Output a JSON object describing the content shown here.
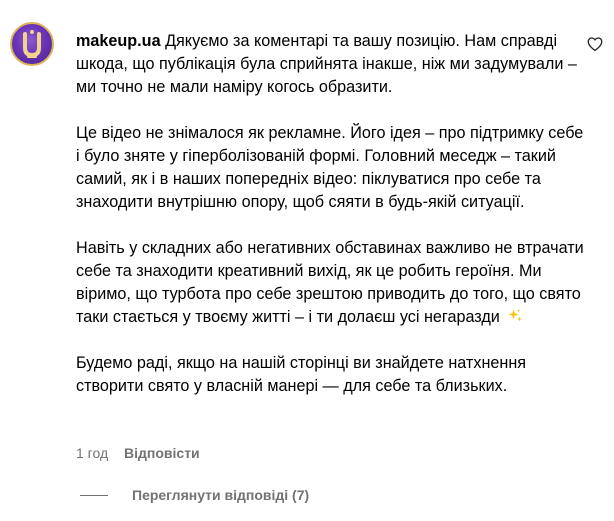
{
  "comment": {
    "username": "makeup.ua",
    "paragraph_1": "Дякуємо за коментарі та вашу позицію. Нам справді шкода, що публікація була сприйнята інакше, ніж ми задумували – ми точно не мали наміру когось образити.",
    "paragraph_2": "Це відео не знімалося як рекламне. Його ідея – про підтримку себе і було зняте у гіперболізованій формі. Головний меседж – такий самий, як і в наших попередніх відео: піклуватися про себе та знаходити внутрішню опору, щоб сяяти в будь-якій ситуації.",
    "paragraph_3": "Навіть у складних або негативних обставинах важливо не втрачати себе та знаходити креативний вихід, як це робить героїня. Ми віримо, що турбота про себе зрештою приводить до того, що свято таки стається у твоєму житті – і ти долаєш усі негаразди",
    "paragraph_4": "Будемо раді, якщо на нашій сторінці ви знайдете натхнення створити свято у власній манері — для себе та близьких.",
    "time": "1 год",
    "reply_label": "Відповісти",
    "view_replies_label": "Переглянути відповіді (7)",
    "sparkle_icon": "sparkles-icon",
    "like_icon": "heart-outline-icon"
  },
  "colors": {
    "text": "#000000",
    "muted": "#737373",
    "avatar_purple": "#6a35b8",
    "avatar_gold": "#d9b45a",
    "sparkle": "#f5c518"
  }
}
